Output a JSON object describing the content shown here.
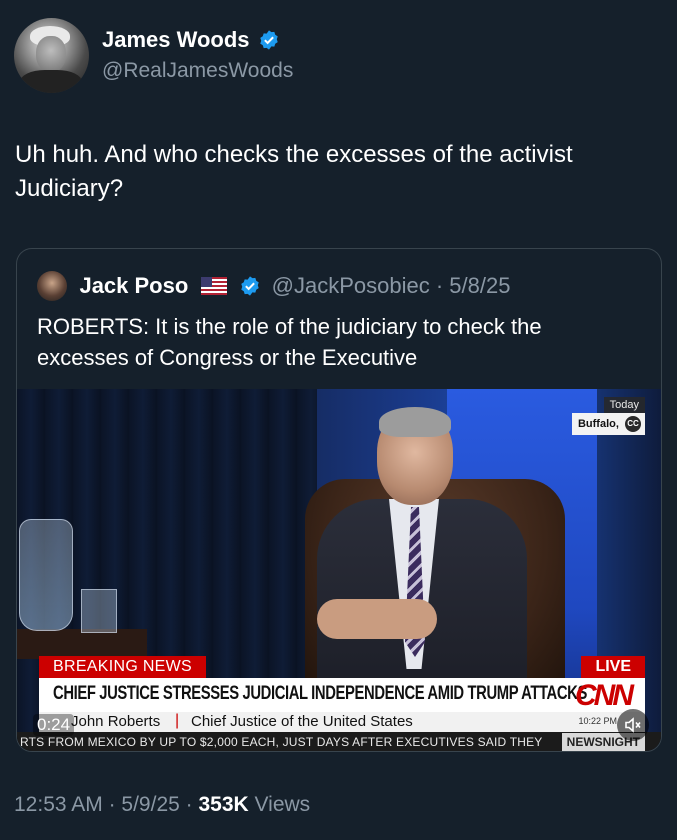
{
  "author": {
    "display_name": "James Woods",
    "handle": "@RealJamesWoods",
    "verified": true
  },
  "tweet": {
    "text": "Uh huh. And who checks the excesses of the activist Judiciary?"
  },
  "quoted_tweet": {
    "display_name": "Jack Poso",
    "handle_date": "@JackPosobiec · 5/8/25",
    "verified": true,
    "text": "ROBERTS: It is the role of the judiciary to check the excesses of Congress or the Executive"
  },
  "video": {
    "corner_line1": "Today",
    "corner_line2": "Buffalo,",
    "cc_label": "CC",
    "breaking_label": "BREAKING NEWS",
    "live_label": "LIVE",
    "headline": "CHIEF JUSTICE STRESSES JUDICIAL INDEPENDENCE AMID TRUMP ATTACKS",
    "network_logo": "CNN",
    "name": "John Roberts",
    "separator": "|",
    "title": "Chief Justice of the United States",
    "clock": "10:22 PM",
    "ticker": "RTS FROM MEXICO BY UP TO $2,000 EACH, JUST DAYS AFTER EXECUTIVES SAID THEY",
    "show_tag": "NEWSNIGHT",
    "elapsed": "0:24"
  },
  "meta": {
    "time": "12:53 AM",
    "dot1": "·",
    "date": "5/9/25",
    "dot2": "·",
    "views_count": "353K",
    "views_label": "Views"
  },
  "colors": {
    "background": "#15202b",
    "accent": "#1d9bf0",
    "secondary_text": "#8b98a5",
    "border": "#38444d",
    "cnn_red": "#cc0000"
  }
}
